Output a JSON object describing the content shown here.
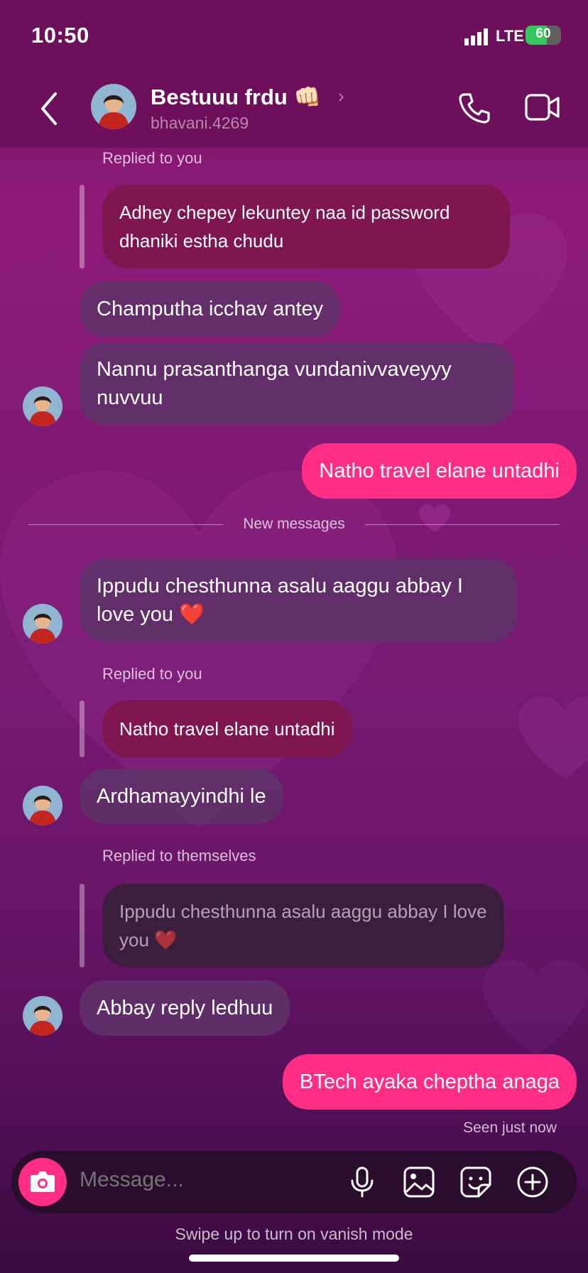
{
  "status": {
    "time": "10:50",
    "network": "LTE",
    "battery": "60"
  },
  "header": {
    "name": "Bestuuu frdu 👊🏻",
    "username": "bhavani.4269"
  },
  "messages": {
    "m1_meta": "Replied to you",
    "m1_quote": "Adhey chepey lekuntey naa id password dhaniki estha chudu",
    "m2": "Champutha icchav antey",
    "m3": "Nannu prasanthanga vundanivvaveyyy nuvvuu",
    "m4": "Natho travel elane untadhi",
    "divider": "New messages",
    "m5": "Ippudu chesthunna asalu aaggu abbay I love you ❤️",
    "m6_meta": "Replied to you",
    "m6_quote": "Natho travel elane untadhi",
    "m6": "Ardhamayyindhi le",
    "m7_meta": "Replied to themselves",
    "m7_quote": "Ippudu chesthunna asalu aaggu abbay I love you ❤️",
    "m7": "Abbay reply ledhuu",
    "m8": "BTech ayaka cheptha anaga",
    "seen": "Seen just now"
  },
  "composer": {
    "placeholder": "Message..."
  },
  "footer": {
    "vanish_hint": "Swipe up to turn on vanish mode"
  },
  "icons": [
    "back-arrow-icon",
    "phone-icon",
    "video-icon",
    "camera-icon",
    "microphone-icon",
    "gallery-icon",
    "sticker-icon",
    "plus-circle-icon"
  ],
  "colors": {
    "sent_bubble": "#ff2d84",
    "received_bubble": "#5f3069",
    "header_bg": "#6e0f5c",
    "reply_bubble": "#80164f"
  }
}
